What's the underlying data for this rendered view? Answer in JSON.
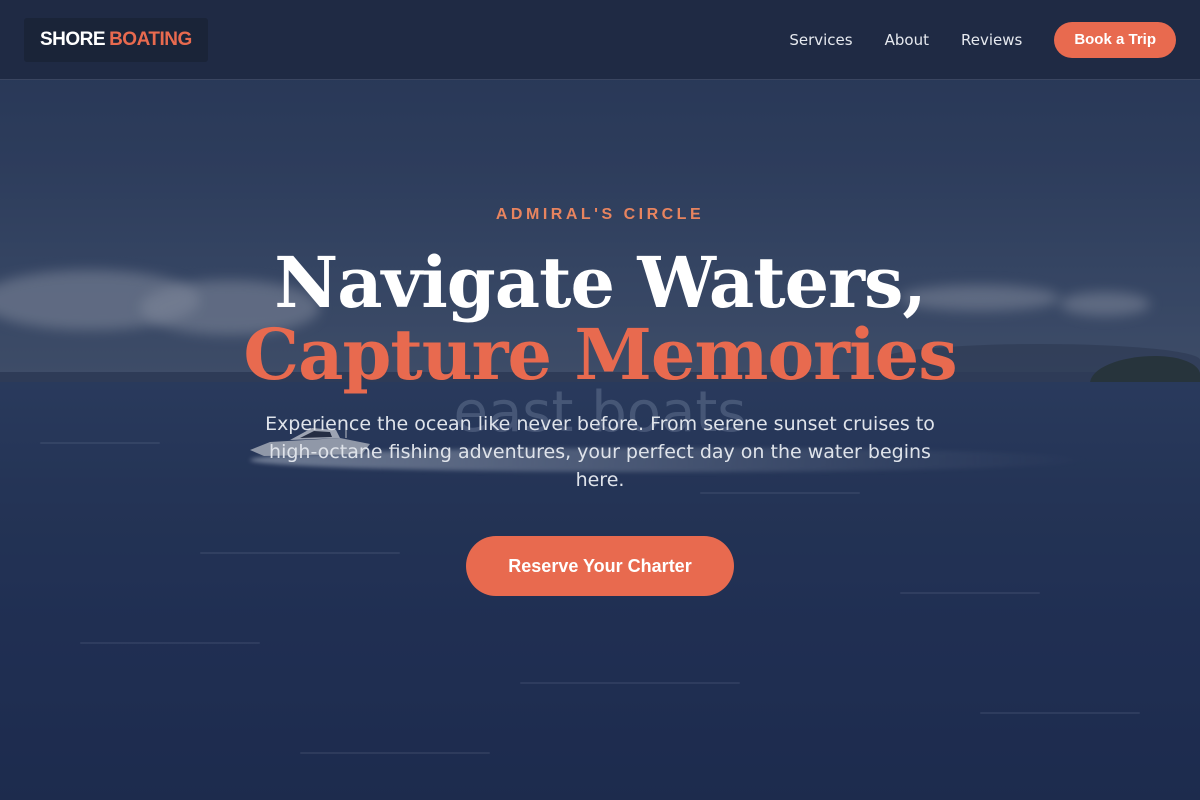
{
  "brand": {
    "first": "SHORE",
    "second": "BOATING"
  },
  "nav": {
    "items": [
      {
        "label": "Services"
      },
      {
        "label": "About"
      },
      {
        "label": "Reviews"
      }
    ],
    "cta_label": "Book a Trip"
  },
  "hero": {
    "eyebrow": "ADMIRAL'S CIRCLE",
    "title_line1": "Navigate Waters,",
    "title_line2": "Capture Memories",
    "background_text": "east boats",
    "subtitle": "Experience the ocean like never before. From serene sunset cruises to high-octane fishing adventures, your perfect day on the water begins here.",
    "cta_label": "Reserve Your Charter"
  },
  "colors": {
    "accent": "#e86a4f",
    "header_bg": "#1f2a44",
    "eyebrow": "#e8845f"
  }
}
